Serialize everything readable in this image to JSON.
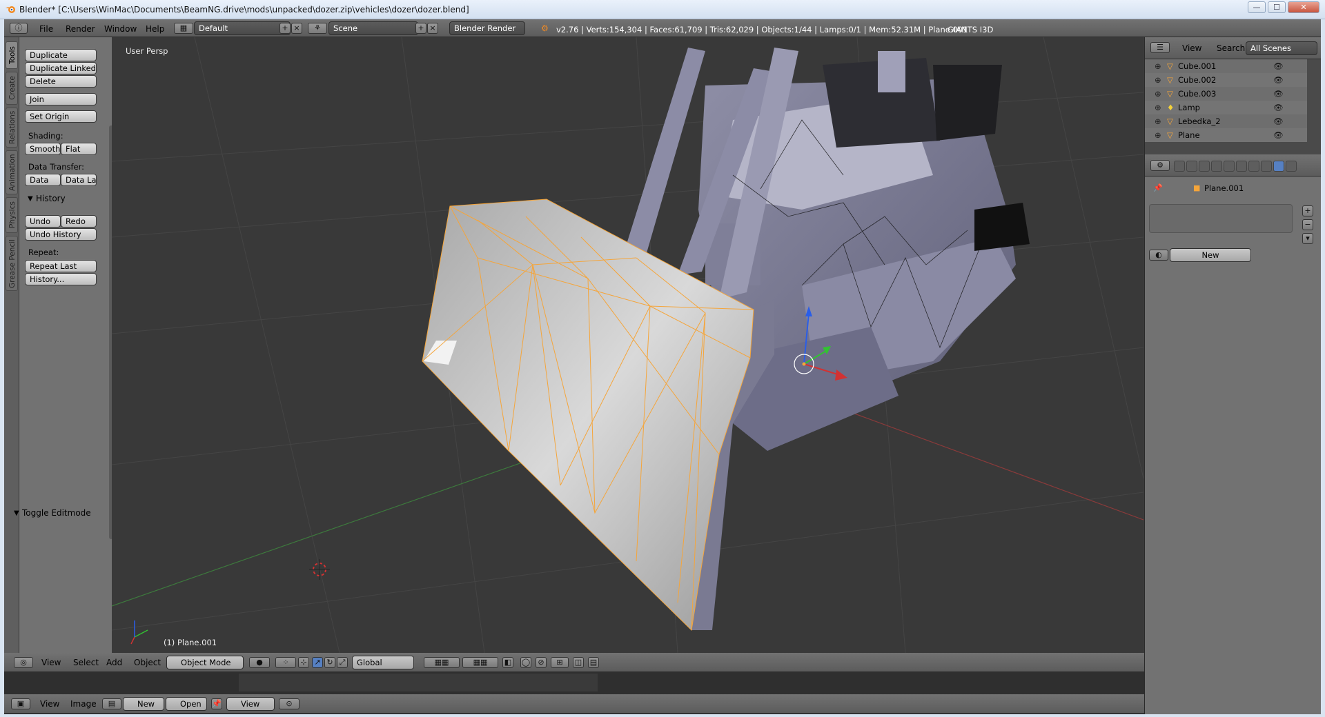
{
  "window": {
    "title": "Blender* [C:\\Users\\WinMac\\Documents\\BeamNG.drive\\mods\\unpacked\\dozer.zip\\vehicles\\dozer\\dozer.blend]",
    "minimize": "—",
    "maximize": "☐",
    "close": "✕"
  },
  "top_bar": {
    "menus": [
      "File",
      "Render",
      "Window",
      "Help"
    ],
    "layout": "Default",
    "scene": "Scene",
    "engine": "Blender Render",
    "stats": "v2.76 | Verts:154,304 | Faces:61,709 | Tris:62,029 | Objects:1/44 | Lamps:0/1 | Mem:52.31M | Plane.001",
    "addon": "GIANTS I3D"
  },
  "tool_shelf": {
    "tabs": [
      "Tools",
      "Create",
      "Relations",
      "Animation",
      "Physics",
      "Grease Pencil"
    ],
    "buttons": {
      "duplicate": "Duplicate",
      "duplicate_linked": "Duplicate Linked",
      "delete": "Delete",
      "join": "Join",
      "set_origin": "Set Origin",
      "smooth": "Smooth",
      "flat": "Flat",
      "data": "Data",
      "data_la": "Data La",
      "undo": "Undo",
      "redo": "Redo",
      "undo_history": "Undo History",
      "repeat_last": "Repeat Last",
      "history": "History..."
    },
    "labels": {
      "shading": "Shading:",
      "data_transfer": "Data Transfer:",
      "history_panel": "History",
      "repeat": "Repeat:",
      "toggle_editmode": "Toggle Editmode"
    }
  },
  "viewport": {
    "view_label": "User Persp",
    "object_label": "(1) Plane.001"
  },
  "viewport_header": {
    "menus": [
      "View",
      "Select",
      "Add",
      "Object"
    ],
    "mode": "Object Mode",
    "orientation": "Global"
  },
  "image_header": {
    "menus": [
      "View",
      "Image"
    ],
    "new_label": "New",
    "open_label": "Open",
    "view_label": "View"
  },
  "outliner": {
    "view": "View",
    "search": "Search",
    "scenes": "All Scenes",
    "items": [
      {
        "name": "Cube.001",
        "icon": "mesh-icon"
      },
      {
        "name": "Cube.002",
        "icon": "mesh-icon"
      },
      {
        "name": "Cube.003",
        "icon": "mesh-icon"
      },
      {
        "name": "Lamp",
        "icon": "lamp-icon"
      },
      {
        "name": "Lebedka_2",
        "icon": "mesh-icon"
      },
      {
        "name": "Plane",
        "icon": "mesh-icon"
      }
    ]
  },
  "properties": {
    "object": "Plane.001",
    "new_label": "New"
  },
  "colors": {
    "selection": "#f5a53a",
    "x_axis": "#b33a3a",
    "y_axis": "#3a8a3a",
    "active_tab": "#5680c2"
  }
}
